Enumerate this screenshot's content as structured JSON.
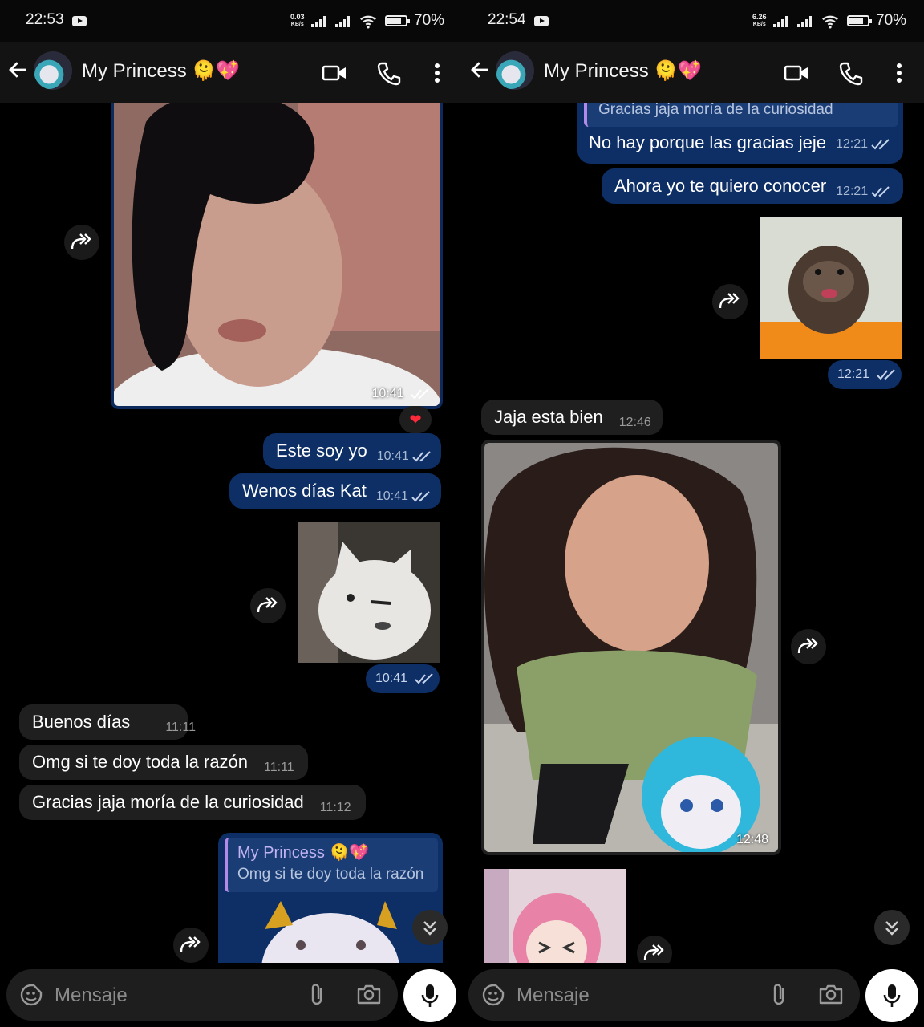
{
  "panels": [
    {
      "status": {
        "time": "22:53",
        "speed_value": "0.03",
        "speed_unit": "KB/s",
        "battery": "70%"
      },
      "chat_title": "My Princess 🫠💖",
      "messages": {
        "photo_time": "10:41",
        "reaction": "❤",
        "este_soy_yo": {
          "text": "Este soy yo",
          "time": "10:41"
        },
        "wenos": {
          "text": "Wenos días Kat",
          "time": "10:41"
        },
        "sticker_time": "10:41",
        "buenos": {
          "text": "Buenos días",
          "time": "11:11"
        },
        "omg": {
          "text": "Omg si te doy toda la razón",
          "time": "11:11"
        },
        "gracias": {
          "text": "Gracias jaja moría de la curiosidad",
          "time": "11:12"
        },
        "reply": {
          "name": "My Princess 🫠💖",
          "text": "Omg si te doy toda la razón"
        }
      },
      "input_placeholder": "Mensaje"
    },
    {
      "status": {
        "time": "22:54",
        "speed_value": "6.26",
        "speed_unit": "KB/s",
        "battery": "70%"
      },
      "chat_title": "My Princess 🫠💖",
      "messages": {
        "quoted": "Gracias jaja moría de la curiosidad",
        "no_hay": {
          "text": "No hay porque las gracias jeje",
          "time": "12:21"
        },
        "ahora": {
          "text": "Ahora yo te quiero conocer",
          "time": "12:21"
        },
        "otter_time": "12:21",
        "jaja": {
          "text": "Jaja esta bien",
          "time": "12:46"
        },
        "selfie_time": "12:48"
      },
      "input_placeholder": "Mensaje"
    }
  ],
  "colors": {
    "outgoing": "#0d2f66",
    "incoming": "#1f1f1f",
    "background": "#000000",
    "header": "#131313"
  },
  "icons": [
    "back-arrow-icon",
    "video-call-icon",
    "phone-icon",
    "more-vert-icon",
    "forward-icon",
    "double-check-icon",
    "sticker-icon",
    "attach-icon",
    "camera-icon",
    "mic-icon",
    "scroll-down-icon",
    "heart-icon"
  ]
}
